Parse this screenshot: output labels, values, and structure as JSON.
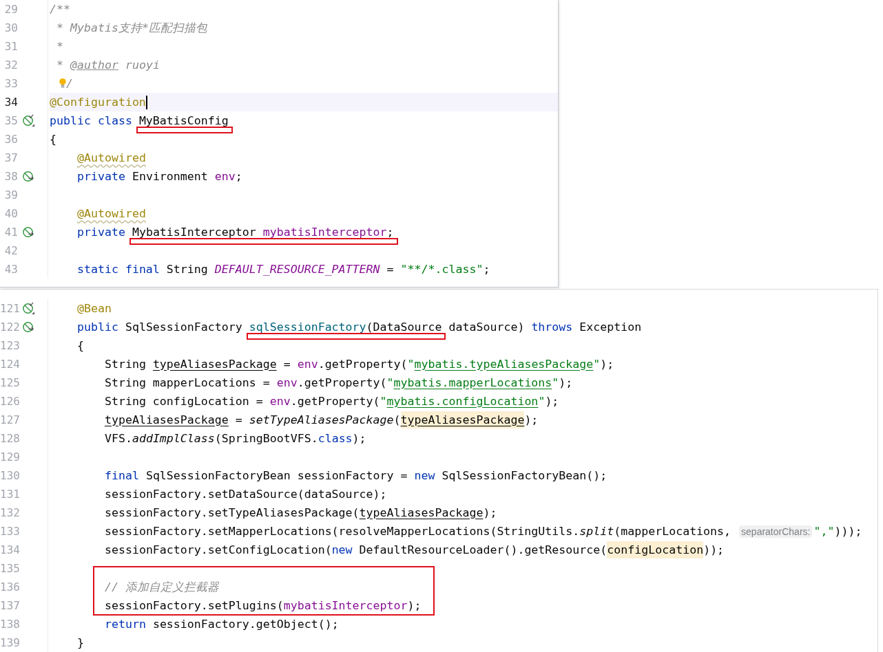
{
  "panels": [
    {
      "lines": [
        {
          "number": "29",
          "tokens": [
            {
              "kind": "comment",
              "text": "/**"
            }
          ]
        },
        {
          "number": "30",
          "tokens": [
            {
              "kind": "comment",
              "text": " * Mybatis支持*匹配扫描包"
            }
          ]
        },
        {
          "number": "31",
          "tokens": [
            {
              "kind": "comment",
              "text": " *"
            }
          ]
        },
        {
          "number": "32",
          "tokens": [
            {
              "kind": "comment",
              "text": " * "
            },
            {
              "kind": "doctag",
              "text": "@author"
            },
            {
              "kind": "comment",
              "text": " ruoyi"
            }
          ]
        },
        {
          "number": "33",
          "bulb": true,
          "tokens": [
            {
              "kind": "comment",
              "text": "/"
            }
          ]
        },
        {
          "number": "34",
          "current": true,
          "caret": true,
          "tokens": [
            {
              "kind": "ann",
              "text": "@Configuration"
            }
          ]
        },
        {
          "number": "35",
          "gutter": {
            "kind": "bean-check"
          },
          "tokens": [
            {
              "kind": "kw",
              "text": "public class "
            },
            {
              "kind": "plain",
              "text": "MyBatisConfig",
              "marked": true
            }
          ]
        },
        {
          "number": "36",
          "tokens": [
            {
              "kind": "plain",
              "text": "{"
            }
          ]
        },
        {
          "number": "37",
          "tokens": [
            {
              "kind": "ann_warn",
              "text": "    @Autowired"
            }
          ]
        },
        {
          "number": "38",
          "gutter": {
            "kind": "bean"
          },
          "tokens": [
            {
              "kind": "kw",
              "text": "    private "
            },
            {
              "kind": "plain",
              "text": "Environment "
            },
            {
              "kind": "field",
              "text": "env"
            },
            {
              "kind": "plain",
              "text": ";"
            }
          ]
        },
        {
          "number": "39"
        },
        {
          "number": "40",
          "tokens": [
            {
              "kind": "ann_warn",
              "text": "    @Autowired"
            }
          ]
        },
        {
          "number": "41",
          "gutter": {
            "kind": "bean"
          },
          "tokens": [
            {
              "kind": "kw",
              "text": "    private "
            },
            {
              "kind": "plain",
              "text": "MybatisInterceptor ",
              "marked": true
            },
            {
              "kind": "field",
              "text": "mybatisInterceptor",
              "marked": true
            },
            {
              "kind": "plain",
              "text": ";",
              "marked": true
            }
          ]
        },
        {
          "number": "42"
        },
        {
          "number": "43",
          "tokens": [
            {
              "kind": "kw",
              "text": "    static final "
            },
            {
              "kind": "plain",
              "text": "String "
            },
            {
              "kind": "const",
              "text": "DEFAULT_RESOURCE_PATTERN"
            },
            {
              "kind": "plain",
              "text": " = "
            },
            {
              "kind": "str",
              "text": "\"**/*.class\""
            },
            {
              "kind": "plain",
              "text": ";"
            }
          ]
        }
      ]
    },
    {
      "lines": [
        {
          "number": "121",
          "gutter": {
            "kind": "bean-check"
          },
          "tokens": [
            {
              "kind": "ann",
              "text": "    @Bean"
            }
          ]
        },
        {
          "number": "122",
          "gutter": {
            "kind": "bean"
          },
          "tokens": [
            {
              "kind": "kw",
              "text": "    public "
            },
            {
              "kind": "plain",
              "text": "SqlSessionFactory "
            },
            {
              "kind": "decl",
              "text": "sqlSessionFactory",
              "marked": true
            },
            {
              "kind": "plain",
              "text": "(DataSource",
              "marked": true
            },
            {
              "kind": "plain",
              "text": " dataSource) "
            },
            {
              "kind": "kw",
              "text": "throws"
            },
            {
              "kind": "plain",
              "text": " Exception"
            }
          ]
        },
        {
          "number": "123",
          "tokens": [
            {
              "kind": "plain",
              "text": "    {"
            }
          ]
        },
        {
          "number": "124",
          "tokens": [
            {
              "kind": "plain",
              "text": "        String "
            },
            {
              "kind": "var",
              "text": "typeAliasesPackage"
            },
            {
              "kind": "plain",
              "text": " = "
            },
            {
              "kind": "field",
              "text": "env"
            },
            {
              "kind": "plain",
              "text": ".getProperty("
            },
            {
              "kind": "str",
              "text": "\""
            },
            {
              "kind": "strlink",
              "text": "mybatis.typeAliasesPackage"
            },
            {
              "kind": "str",
              "text": "\""
            },
            {
              "kind": "plain",
              "text": ");"
            }
          ]
        },
        {
          "number": "125",
          "tokens": [
            {
              "kind": "plain",
              "text": "        String mapperLocations = "
            },
            {
              "kind": "field",
              "text": "env"
            },
            {
              "kind": "plain",
              "text": ".getProperty("
            },
            {
              "kind": "str",
              "text": "\""
            },
            {
              "kind": "strlink",
              "text": "mybatis.mapperLocations"
            },
            {
              "kind": "str",
              "text": "\""
            },
            {
              "kind": "plain",
              "text": ");"
            }
          ]
        },
        {
          "number": "126",
          "tokens": [
            {
              "kind": "plain",
              "text": "        String configLocation = "
            },
            {
              "kind": "field",
              "text": "env"
            },
            {
              "kind": "plain",
              "text": ".getProperty("
            },
            {
              "kind": "str",
              "text": "\""
            },
            {
              "kind": "strlink",
              "text": "mybatis.configLocation"
            },
            {
              "kind": "str",
              "text": "\""
            },
            {
              "kind": "plain",
              "text": ");"
            }
          ]
        },
        {
          "number": "127",
          "tokens": [
            {
              "kind": "var",
              "text": "        typeAliasesPackage"
            },
            {
              "kind": "plain",
              "text": " = "
            },
            {
              "kind": "static",
              "text": "setTypeAliasesPackage"
            },
            {
              "kind": "plain",
              "text": "("
            },
            {
              "kind": "var_hl",
              "text": "typeAliasesPackage"
            },
            {
              "kind": "plain",
              "text": ");"
            }
          ]
        },
        {
          "number": "128",
          "tokens": [
            {
              "kind": "plain",
              "text": "        VFS."
            },
            {
              "kind": "static",
              "text": "addImplClass"
            },
            {
              "kind": "plain",
              "text": "(SpringBootVFS."
            },
            {
              "kind": "kw",
              "text": "class"
            },
            {
              "kind": "plain",
              "text": ");"
            }
          ]
        },
        {
          "number": "129"
        },
        {
          "number": "130",
          "tokens": [
            {
              "kind": "kw",
              "text": "        final "
            },
            {
              "kind": "plain",
              "text": "SqlSessionFactoryBean sessionFactory = "
            },
            {
              "kind": "kw",
              "text": "new"
            },
            {
              "kind": "plain",
              "text": " SqlSessionFactoryBean();"
            }
          ]
        },
        {
          "number": "131",
          "tokens": [
            {
              "kind": "plain",
              "text": "        sessionFactory.setDataSource(dataSource);"
            }
          ]
        },
        {
          "number": "132",
          "tokens": [
            {
              "kind": "plain",
              "text": "        sessionFactory.setTypeAliasesPackage("
            },
            {
              "kind": "var",
              "text": "typeAliasesPackage"
            },
            {
              "kind": "plain",
              "text": ");"
            }
          ]
        },
        {
          "number": "133",
          "tokens": [
            {
              "kind": "plain",
              "text": "        sessionFactory.setMapperLocations(resolveMapperLocations(StringUtils."
            },
            {
              "kind": "static",
              "text": "split"
            },
            {
              "kind": "plain",
              "text": "(mapperLocations, "
            },
            {
              "kind": "hint",
              "text": "separatorChars:"
            },
            {
              "kind": "str",
              "text": "\",\""
            },
            {
              "kind": "plain",
              "text": ")));"
            }
          ]
        },
        {
          "number": "134",
          "tokens": [
            {
              "kind": "plain",
              "text": "        sessionFactory.setConfigLocation("
            },
            {
              "kind": "kw",
              "text": "new"
            },
            {
              "kind": "plain",
              "text": " DefaultResourceLoader().getResource("
            },
            {
              "kind": "hl",
              "text": "configLocation"
            },
            {
              "kind": "plain",
              "text": "));"
            }
          ]
        },
        {
          "number": "135"
        },
        {
          "number": "136",
          "boxed": true,
          "tokens": [
            {
              "kind": "comment",
              "text": "        // 添加自定义拦截器"
            }
          ]
        },
        {
          "number": "137",
          "tokens": [
            {
              "kind": "plain",
              "text": "        sessionFactory.setPlugins("
            },
            {
              "kind": "field",
              "text": "mybatisInterceptor"
            },
            {
              "kind": "plain",
              "text": ");"
            }
          ]
        },
        {
          "number": "138",
          "tokens": [
            {
              "kind": "kw",
              "text": "        return"
            },
            {
              "kind": "plain",
              "text": " sessionFactory.getObject();"
            }
          ]
        },
        {
          "number": "139",
          "tokens": [
            {
              "kind": "plain",
              "text": "    }"
            }
          ]
        }
      ]
    }
  ]
}
